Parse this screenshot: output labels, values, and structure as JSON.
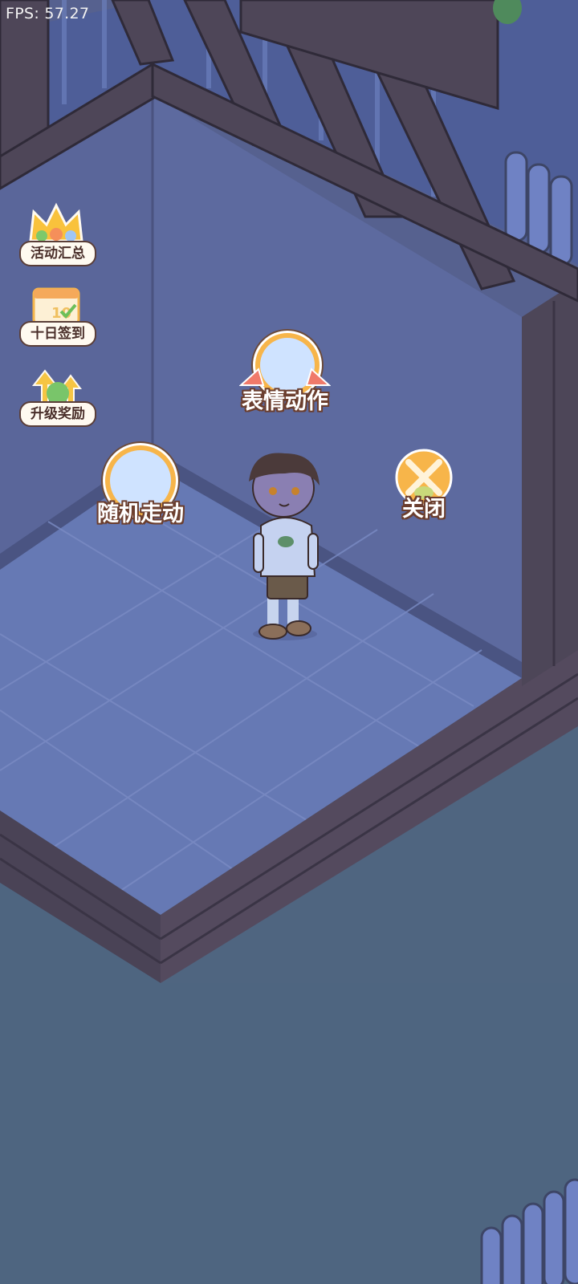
{
  "hud": {
    "fps_text": "FPS: 57.27"
  },
  "side_menu": [
    {
      "id": "events",
      "label": "活动汇总",
      "icon": "crown-icon"
    },
    {
      "id": "checkin",
      "label": "十日签到",
      "icon": "calendar-gift-icon"
    },
    {
      "id": "upgrade",
      "label": "升级奖励",
      "icon": "upgrade-arrows-icon"
    }
  ],
  "character_menu": {
    "emote": {
      "label": "表情动作",
      "icon": "emote-figure-icon"
    },
    "wander": {
      "label": "随机走动",
      "icon": "walking-figure-icon"
    },
    "close": {
      "label": "关闭",
      "icon": "close-x-icon"
    }
  },
  "colors": {
    "background": "#4f6580",
    "wall": "#5f6ea3",
    "floor": "#6a7db8",
    "wood": "#4a4356",
    "button_orange": "#f7b54a",
    "label_outline": "#6b3e2e"
  }
}
